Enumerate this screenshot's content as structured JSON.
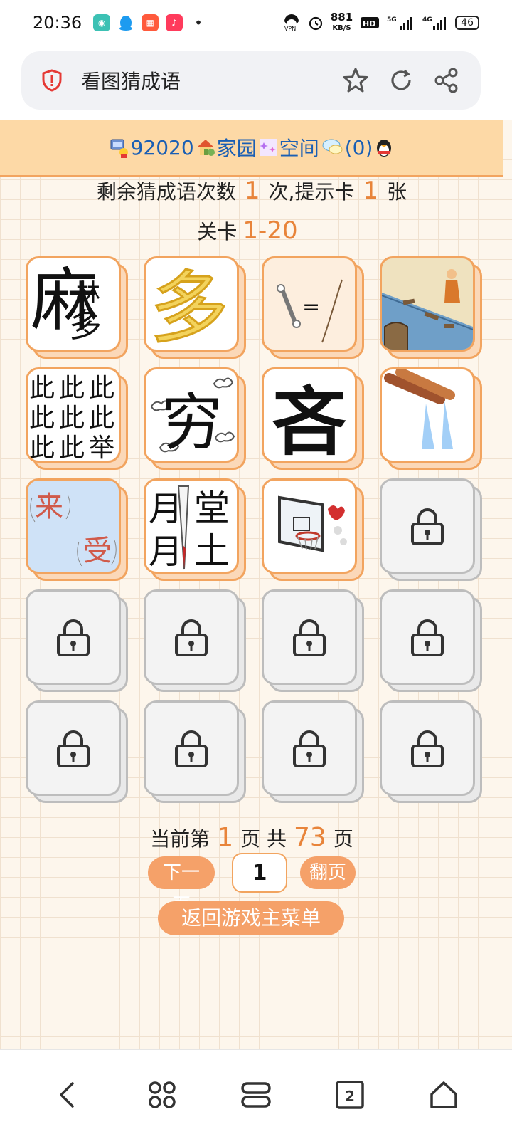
{
  "status_bar": {
    "time": "20:36",
    "speed_value": "881",
    "speed_unit": "KB/S",
    "battery": "46",
    "dot": "•"
  },
  "browser": {
    "title": "看图猜成语"
  },
  "nav_banner": {
    "points": "92020",
    "home_label": "家园",
    "space_label": "空间",
    "messages": "(0)"
  },
  "game": {
    "remaining_prefix": "剩余猜成语次数",
    "remaining_count": "1",
    "remaining_mid": "次,提示卡",
    "hint_count": "1",
    "hint_suffix": "张",
    "level_prefix": "关卡",
    "level_range": "1-20"
  },
  "tiles": [
    {
      "state": "open",
      "image": "mo-character-puzzle"
    },
    {
      "state": "open",
      "image": "duo-money-chain"
    },
    {
      "state": "open",
      "image": "bone-equals-stick"
    },
    {
      "state": "open",
      "image": "river-broken-bridge"
    },
    {
      "state": "open",
      "image": "ci-ci-ju-grid"
    },
    {
      "state": "open",
      "image": "qiong-clouds"
    },
    {
      "state": "open",
      "image": "ge-character"
    },
    {
      "state": "open",
      "image": "pipe-water"
    },
    {
      "state": "open",
      "image": "lai-shou-arrows"
    },
    {
      "state": "open",
      "image": "yue-tang-tu-knife"
    },
    {
      "state": "open",
      "image": "basketball-hoop"
    },
    {
      "state": "locked"
    },
    {
      "state": "locked"
    },
    {
      "state": "locked"
    },
    {
      "state": "locked"
    },
    {
      "state": "locked"
    },
    {
      "state": "locked"
    },
    {
      "state": "locked"
    },
    {
      "state": "locked"
    },
    {
      "state": "locked"
    }
  ],
  "tile_text": {
    "mo_top": "麻",
    "mo_bottom_1": "林",
    "mo_bottom_2": "多",
    "duo": "多",
    "equals": "=",
    "ci": "此",
    "ju": "举",
    "qiong": "穷",
    "ge": "吝",
    "lai": "来",
    "shou": "受",
    "yue": "月",
    "tang": "堂",
    "tu": "土"
  },
  "pager": {
    "prefix": "当前第",
    "current": "1",
    "mid": "页 共",
    "total": "73",
    "suffix": "页",
    "next_label": "下一页",
    "input_value": "1",
    "go_label": "翻页",
    "menu_label": "返回游戏主菜单"
  },
  "bottom_nav": {
    "tabs_count": "2"
  },
  "colors": {
    "accent": "#e8843a",
    "button": "#f5a169",
    "banner": "#fdd9a6",
    "link": "#1a5fb4"
  }
}
